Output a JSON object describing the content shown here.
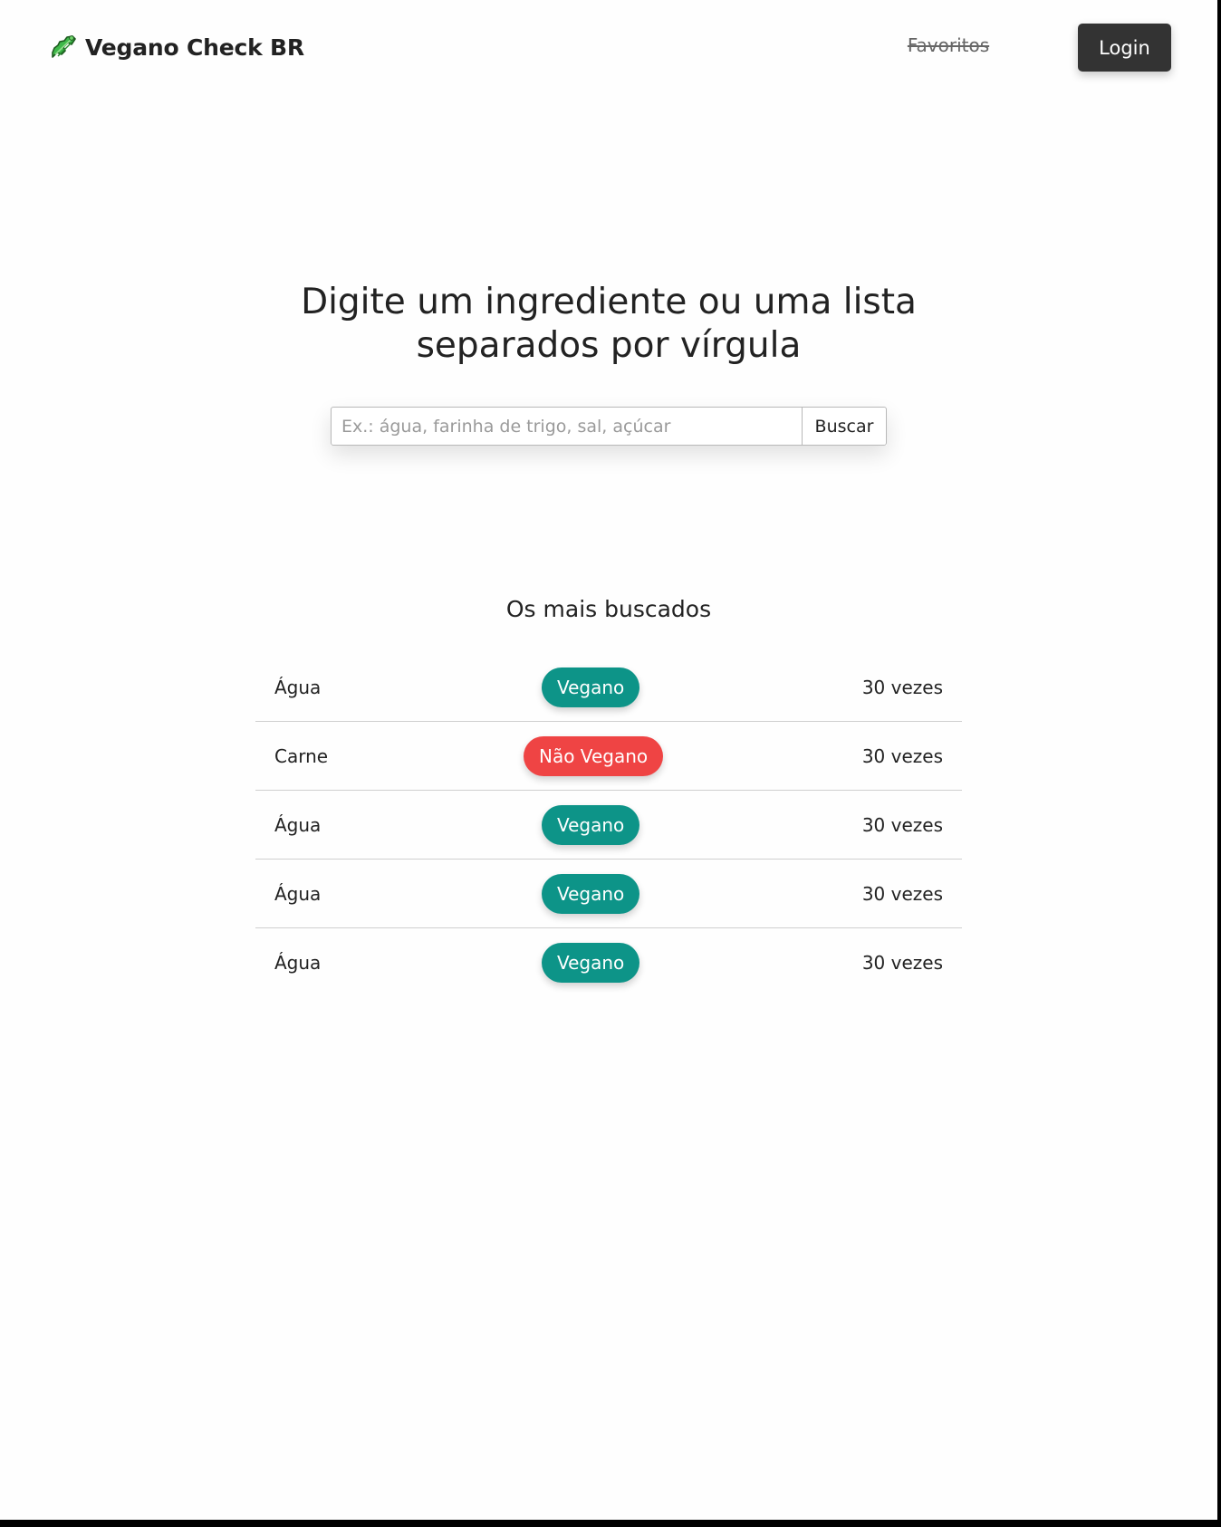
{
  "colors": {
    "vegan": "#0d9488",
    "non_vegan": "#ef4444",
    "login_bg": "#333333",
    "text": "#222222"
  },
  "header": {
    "brand_icon": "celery-icon",
    "brand_name": "Vegano Check BR",
    "favorites_label": "Favoritos",
    "login_label": "Login"
  },
  "hero": {
    "title": "Digite um ingrediente ou uma lista separados por vírgula"
  },
  "search": {
    "placeholder": "Ex.: água, farinha de trigo, sal, açúcar",
    "value": "",
    "button_label": "Buscar"
  },
  "top_searches": {
    "title": "Os mais buscados",
    "rows": [
      {
        "name": "Água",
        "status": "Vegano",
        "count": "30 vezes"
      },
      {
        "name": "Carne",
        "status": "Não Vegano",
        "count": "30 vezes"
      },
      {
        "name": "Água",
        "status": "Vegano",
        "count": "30 vezes"
      },
      {
        "name": "Água",
        "status": "Vegano",
        "count": "30 vezes"
      },
      {
        "name": "Água",
        "status": "Vegano",
        "count": "30 vezes"
      }
    ]
  }
}
